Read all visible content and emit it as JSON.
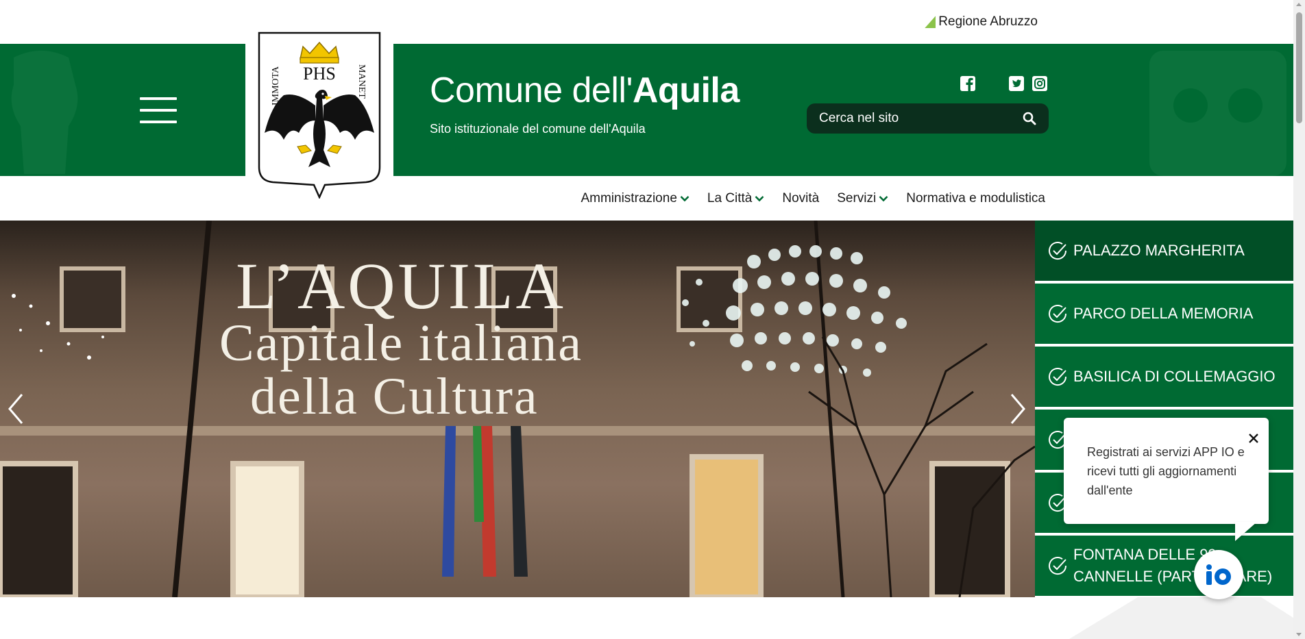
{
  "topbar": {
    "region_link": "Regione Abruzzo"
  },
  "header": {
    "title_prefix": "Comune dell'",
    "title_bold": "Aquila",
    "subtitle": "Sito istituzionale del comune dell'Aquila",
    "logo": {
      "left_text": "IMMOTA",
      "right_text": "MANET",
      "center_text": "PHS"
    },
    "search_placeholder": "Cerca nel sito",
    "social": [
      "facebook-icon",
      "twitter-icon",
      "instagram-icon"
    ]
  },
  "nav": {
    "items": [
      {
        "label": "Amministrazione",
        "dropdown": true
      },
      {
        "label": "La Città",
        "dropdown": true
      },
      {
        "label": "Novità",
        "dropdown": false
      },
      {
        "label": "Servizi",
        "dropdown": true
      },
      {
        "label": "Normativa e modulistica",
        "dropdown": false
      }
    ]
  },
  "hero": {
    "line1": "L’AQUILA",
    "line2": "Capitale italiana",
    "line3": "della Cultura"
  },
  "side_list": {
    "items": [
      {
        "label": "PALAZZO MARGHERITA"
      },
      {
        "label": "PARCO DELLA MEMORIA"
      },
      {
        "label": "BASILICA DI COLLEMAGGIO"
      },
      {
        "label": ""
      },
      {
        "label": ""
      },
      {
        "label_line1": "FONTANA DELLE 99",
        "label_line2": "CANNELLE (PARTICOLARE)"
      }
    ]
  },
  "popup": {
    "text": "Registrati ai servizi APP IO e ricevi tutti gli aggiornamenti dall'ente"
  },
  "colors": {
    "brand_green": "#006a33",
    "active_green": "#014f26",
    "search_bg": "#0b2f1d",
    "io_blue": "#0066cc"
  }
}
